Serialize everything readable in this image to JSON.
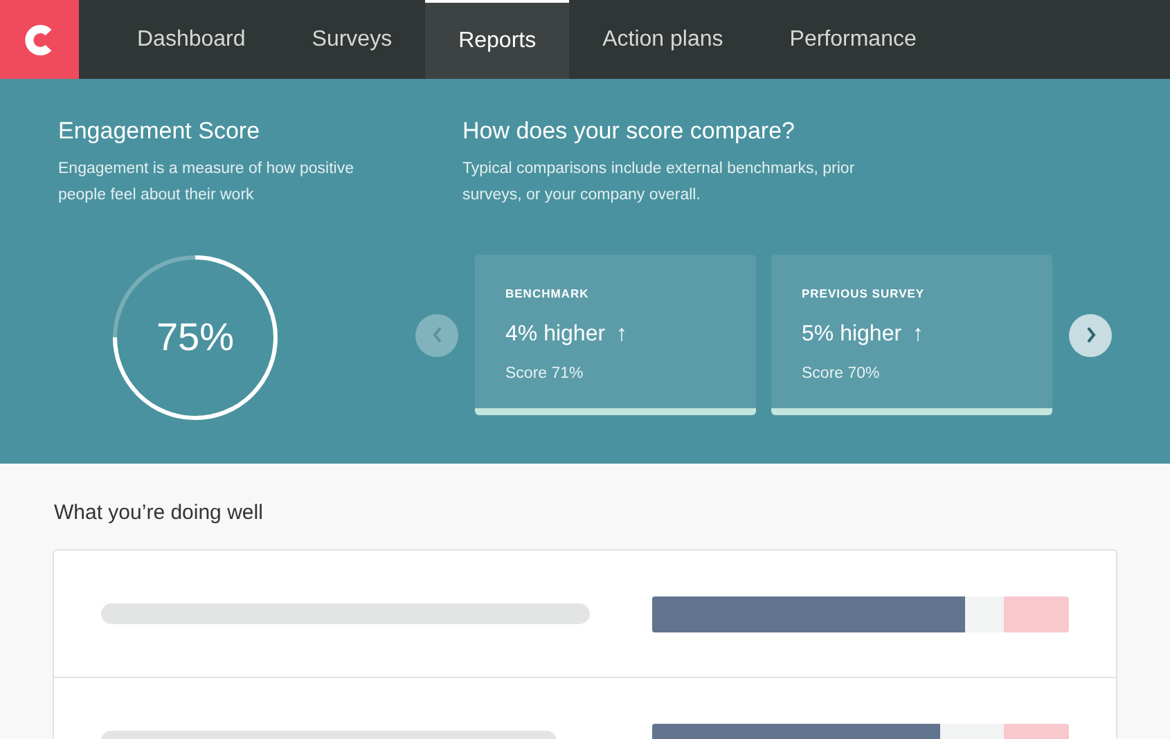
{
  "nav": {
    "tabs": [
      {
        "label": "Dashboard",
        "selected": false
      },
      {
        "label": "Surveys",
        "selected": false
      },
      {
        "label": "Reports",
        "selected": true
      },
      {
        "label": "Action plans",
        "selected": false
      },
      {
        "label": "Performance",
        "selected": false
      }
    ]
  },
  "engagement": {
    "title": "Engagement Score",
    "description": "Engagement is a measure of how positive people feel about their work",
    "score": "75%",
    "level": 0.75
  },
  "compare": {
    "title": "How does your score compare?",
    "description": "Typical comparisons include external benchmarks, prior surveys, or your company overall.",
    "prev_disabled": true,
    "cards": [
      {
        "label": "BENCHMARK",
        "value": "4% higher",
        "arrow": "↑",
        "score": "Score 71%"
      },
      {
        "label": "PREVIOUS SURVEY",
        "value": "5% higher",
        "arrow": "↑",
        "score": "Score 70%"
      }
    ]
  },
  "doing_well": {
    "title": "What you’re doing well",
    "rows": [
      {
        "level": 0.75
      },
      {
        "level": 0.69
      }
    ]
  }
}
